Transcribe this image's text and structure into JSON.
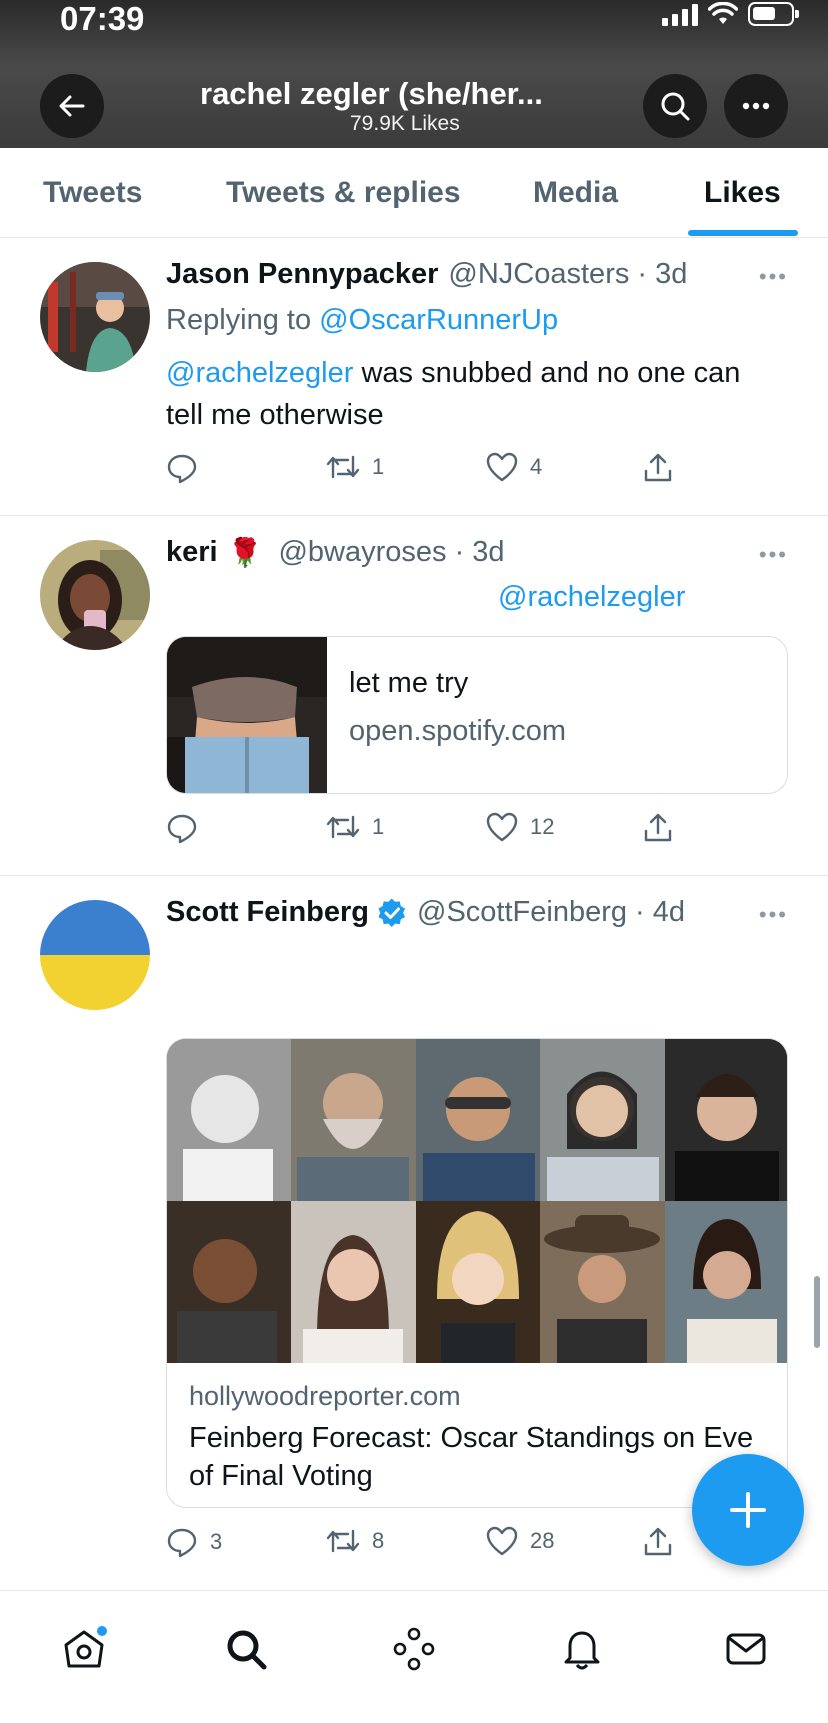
{
  "status_bar": {
    "time": "07:39"
  },
  "header": {
    "title": "rachel zegler (she/her...",
    "subtitle": "79.9K Likes"
  },
  "tabs": [
    {
      "label": "Tweets"
    },
    {
      "label": "Tweets & replies"
    },
    {
      "label": "Media"
    },
    {
      "label": "Likes"
    }
  ],
  "tweets": [
    {
      "name": "Jason Pennypacker",
      "handle": "@NJCoasters · 3d",
      "replying_label": "Replying to",
      "replying_to": "@OscarRunnerUp",
      "mention": "@rachelzegler",
      "text": " was snubbed and no one can tell me otherwise",
      "retweets": "1",
      "likes": "4"
    },
    {
      "name": "keri",
      "emoji": "🌹",
      "handle": "@bwayroses · 3d",
      "mention": "@rachelzegler",
      "card_title": "let me try",
      "card_domain": "open.spotify.com",
      "retweets": "1",
      "likes": "12"
    },
    {
      "name": "Scott Feinberg",
      "handle": "@ScottFeinberg · 4d",
      "card_domain": "hollywoodreporter.com",
      "card_title": "Feinberg Forecast: Oscar Standings on Eve of Final Voting",
      "replies": "3",
      "retweets": "8",
      "likes": "28"
    }
  ],
  "colors": {
    "accent": "#1d9bf0",
    "text": "#0f1419",
    "muted": "#536471"
  },
  "icons": [
    "back-arrow-icon",
    "search-icon",
    "more-icon",
    "reply-icon",
    "retweet-icon",
    "like-icon",
    "share-icon",
    "verified-icon",
    "compose-plus-icon",
    "home-icon",
    "explore-icon",
    "spaces-icon",
    "notifications-icon",
    "messages-icon"
  ]
}
